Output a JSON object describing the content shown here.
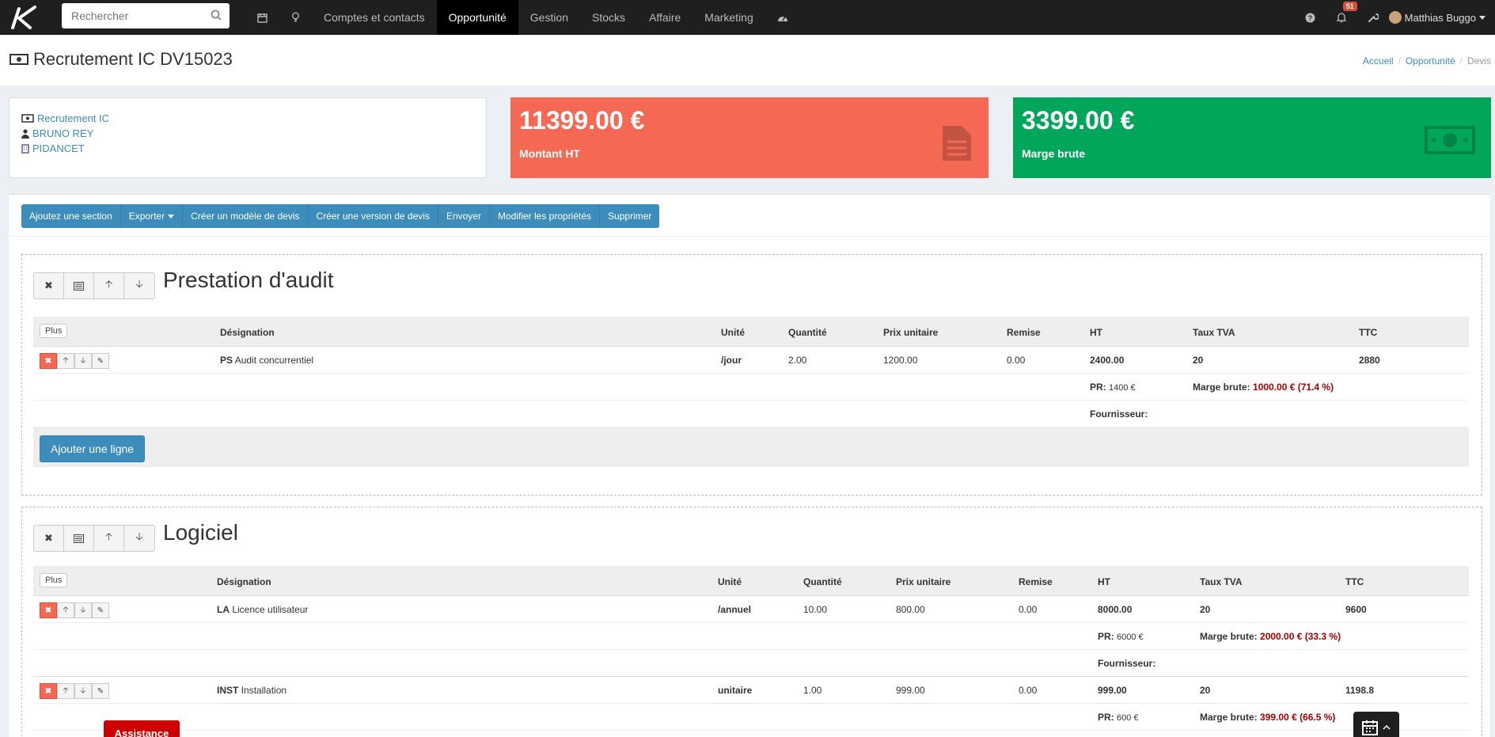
{
  "search": {
    "placeholder": "Rechercher"
  },
  "nav": {
    "items": [
      {
        "label": "Comptes et contacts"
      },
      {
        "label": "Opportunité"
      },
      {
        "label": "Gestion"
      },
      {
        "label": "Stocks"
      },
      {
        "label": "Affaire"
      },
      {
        "label": "Marketing"
      }
    ],
    "active": "Opportunité"
  },
  "notifications": {
    "count": "51"
  },
  "user": {
    "name": "Matthias Buggo"
  },
  "page": {
    "title": "Recrutement IC DV15023"
  },
  "breadcrumb": {
    "home": "Accueil",
    "parent": "Opportunité",
    "current": "Devis"
  },
  "info": {
    "opportunity": "Recrutement IC",
    "contact": "BRUNO REY",
    "company": "PIDANCET"
  },
  "stats": {
    "amount": {
      "value": "11399.00 €",
      "label": "Montant HT"
    },
    "margin": {
      "value": "3399.00 €",
      "label": "Marge brute"
    }
  },
  "toolbar": {
    "add_section": "Ajoutez une section",
    "export": "Exporter",
    "create_template": "Créer un modèle de devis",
    "create_version": "Créer une version de devis",
    "send": "Envoyer",
    "edit_props": "Modifier les propriétés",
    "delete": "Supprimer"
  },
  "columns": {
    "plus": "Plus",
    "designation": "Désignation",
    "unit": "Unité",
    "qty": "Quantité",
    "price": "Prix unitaire",
    "discount": "Remise",
    "ht": "HT",
    "vat": "Taux TVA",
    "ttc": "TTC"
  },
  "labels": {
    "pr": "PR:",
    "margin": "Marge brute:",
    "supplier": "Fournisseur:",
    "add_line": "Ajouter une ligne"
  },
  "sections": [
    {
      "title": "Prestation d'audit",
      "lines": [
        {
          "code": "PS",
          "name": "Audit concurrentiel",
          "unit": "/jour",
          "qty": "2.00",
          "price": "1200.00",
          "discount": "0.00",
          "ht": "2400.00",
          "vat": "20",
          "ttc": "2880",
          "pr": "1400 €",
          "margin": "1000.00 € (71.4 %)"
        }
      ]
    },
    {
      "title": "Logiciel",
      "lines": [
        {
          "code": "LA",
          "name": "Licence utilisateur",
          "unit": "/annuel",
          "qty": "10.00",
          "price": "800.00",
          "discount": "0.00",
          "ht": "8000.00",
          "vat": "20",
          "ttc": "9600",
          "pr": "6000 €",
          "margin": "2000.00 € (33.3 %)"
        },
        {
          "code": "INST",
          "name": "Installation",
          "unit": "unitaire",
          "qty": "1.00",
          "price": "999.00",
          "discount": "0.00",
          "ht": "999.00",
          "vat": "20",
          "ttc": "1198.8",
          "pr": "600 €",
          "margin": "399.00 € (66.5 %)"
        }
      ]
    }
  ],
  "assist": {
    "label": "Assistance"
  },
  "colors": {
    "red": "#f56954",
    "green": "#00a65a",
    "primary": "#3c8dbc",
    "topbar": "#1f1f1f"
  }
}
